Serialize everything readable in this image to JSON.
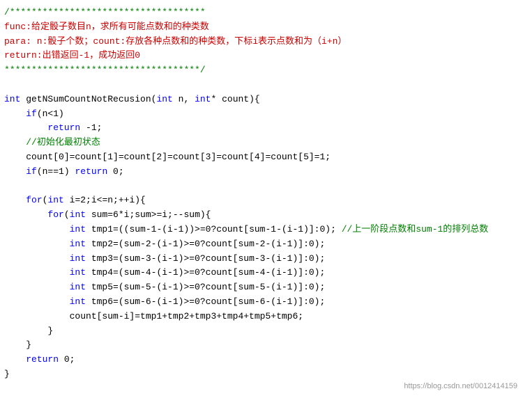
{
  "watermark": "https://blog.csdn.net/0012414159",
  "code": {
    "lines": [
      {
        "id": 1,
        "type": "comment",
        "text": "/************************************"
      },
      {
        "id": 2,
        "type": "comment-cn",
        "text": "func:给定骰子数目n，求所有可能点数和的种类数"
      },
      {
        "id": 3,
        "type": "comment-cn",
        "text": "para: n:骰子个数；count:存放各种点数和的种类数，下标i表示点数和为（i+n）"
      },
      {
        "id": 4,
        "type": "comment-cn",
        "text": "return:出错返回-1，成功返回0"
      },
      {
        "id": 5,
        "type": "comment",
        "text": "************************************/"
      },
      {
        "id": 6,
        "type": "blank",
        "text": ""
      },
      {
        "id": 7,
        "type": "code",
        "text": "int getNSumCountNotRecusion(int n, int* count){"
      },
      {
        "id": 8,
        "type": "code",
        "text": "    if(n<1)"
      },
      {
        "id": 9,
        "type": "code",
        "text": "        return -1;"
      },
      {
        "id": 10,
        "type": "code-comment",
        "text": "    //初始化最初状态"
      },
      {
        "id": 11,
        "type": "code",
        "text": "    count[0]=count[1]=count[2]=count[3]=count[4]=count[5]=1;"
      },
      {
        "id": 12,
        "type": "code",
        "text": "    if(n==1) return 0;"
      },
      {
        "id": 13,
        "type": "blank",
        "text": ""
      },
      {
        "id": 14,
        "type": "code",
        "text": "    for(int i=2;i<=n;++i){"
      },
      {
        "id": 15,
        "type": "code",
        "text": "        for(int sum=6*i;sum>=i;--sum){"
      },
      {
        "id": 16,
        "type": "code-with-comment",
        "text": "            int tmp1=((sum-1-(i-1))>=0?count[sum-1-(i-1)]:0); //上一阶段点数和sum-1的排列总数"
      },
      {
        "id": 17,
        "type": "code",
        "text": "            int tmp2=(sum-2-(i-1)>=0?count[sum-2-(i-1)]:0);"
      },
      {
        "id": 18,
        "type": "code",
        "text": "            int tmp3=(sum-3-(i-1)>=0?count[sum-3-(i-1)]:0);"
      },
      {
        "id": 19,
        "type": "code",
        "text": "            int tmp4=(sum-4-(i-1)>=0?count[sum-4-(i-1)]:0);"
      },
      {
        "id": 20,
        "type": "code",
        "text": "            int tmp5=(sum-5-(i-1)>=0?count[sum-5-(i-1)]:0);"
      },
      {
        "id": 21,
        "type": "code",
        "text": "            int tmp6=(sum-6-(i-1)>=0?count[sum-6-(i-1)]:0);"
      },
      {
        "id": 22,
        "type": "code",
        "text": "            count[sum-i]=tmp1+tmp2+tmp3+tmp4+tmp5+tmp6;"
      },
      {
        "id": 23,
        "type": "code",
        "text": "        }"
      },
      {
        "id": 24,
        "type": "code",
        "text": "    }"
      },
      {
        "id": 25,
        "type": "code",
        "text": "    return 0;"
      },
      {
        "id": 26,
        "type": "code",
        "text": "}"
      }
    ]
  }
}
